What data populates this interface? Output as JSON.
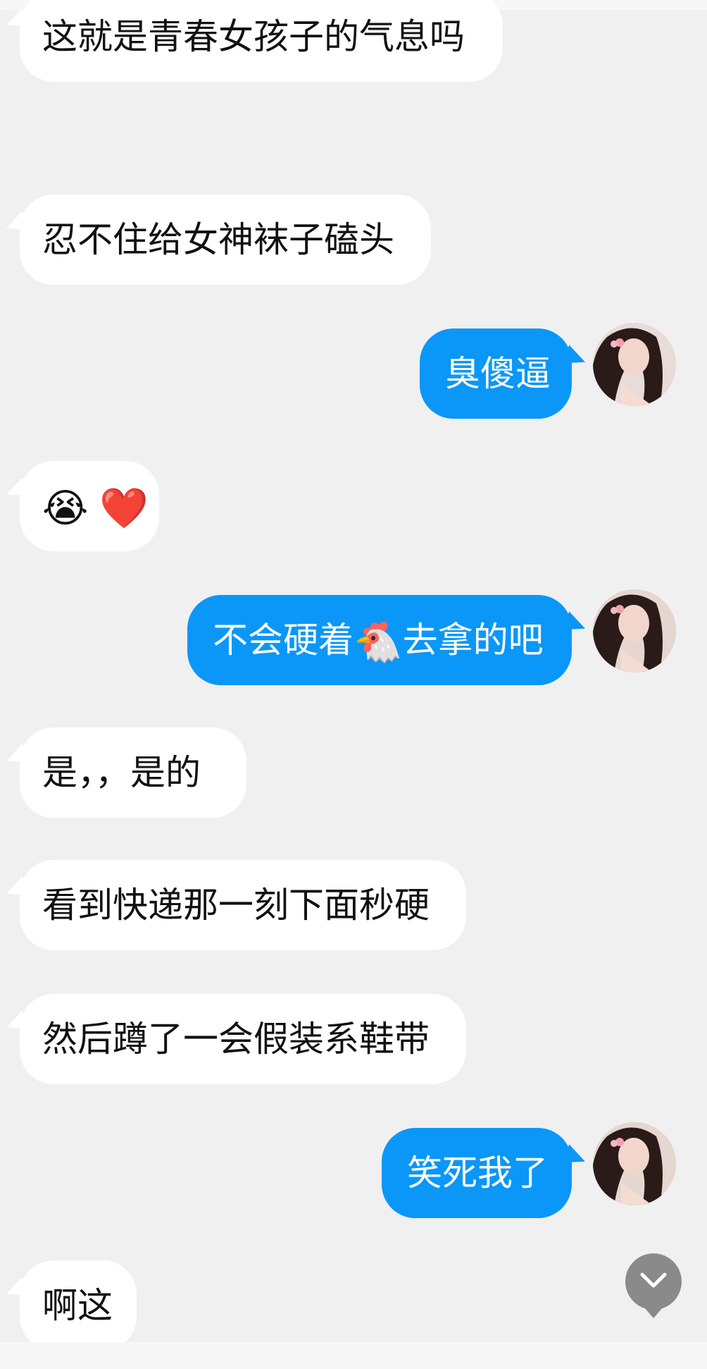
{
  "colors": {
    "background": "#f0f0f0",
    "received_bubble": "#ffffff",
    "sent_bubble": "#0a97f8",
    "received_text": "#111111",
    "sent_text": "#ffffff"
  },
  "messages": [
    {
      "side": "received",
      "text": "这就是青春女孩子的气息吗"
    },
    {
      "side": "received",
      "text": "忍不住给女神袜子磕头"
    },
    {
      "side": "sent",
      "text": "臭傻逼",
      "avatar": "avatar-girl"
    },
    {
      "side": "received",
      "text": "",
      "emojis": [
        "😭",
        "❤️"
      ]
    },
    {
      "side": "sent",
      "text_before": "不会硬着",
      "emoji": "🐔",
      "text_after": "去拿的吧",
      "avatar": "avatar-girl"
    },
    {
      "side": "received",
      "text": "是，，是的"
    },
    {
      "side": "received",
      "text": "看到快递那一刻下面秒硬"
    },
    {
      "side": "received",
      "text": "然后蹲了一会假装系鞋带"
    },
    {
      "side": "sent",
      "text": "笑死我了",
      "avatar": "avatar-girl"
    },
    {
      "side": "received",
      "text": "啊这"
    }
  ],
  "scroll_button": {
    "icon": "chevron-down-icon"
  }
}
